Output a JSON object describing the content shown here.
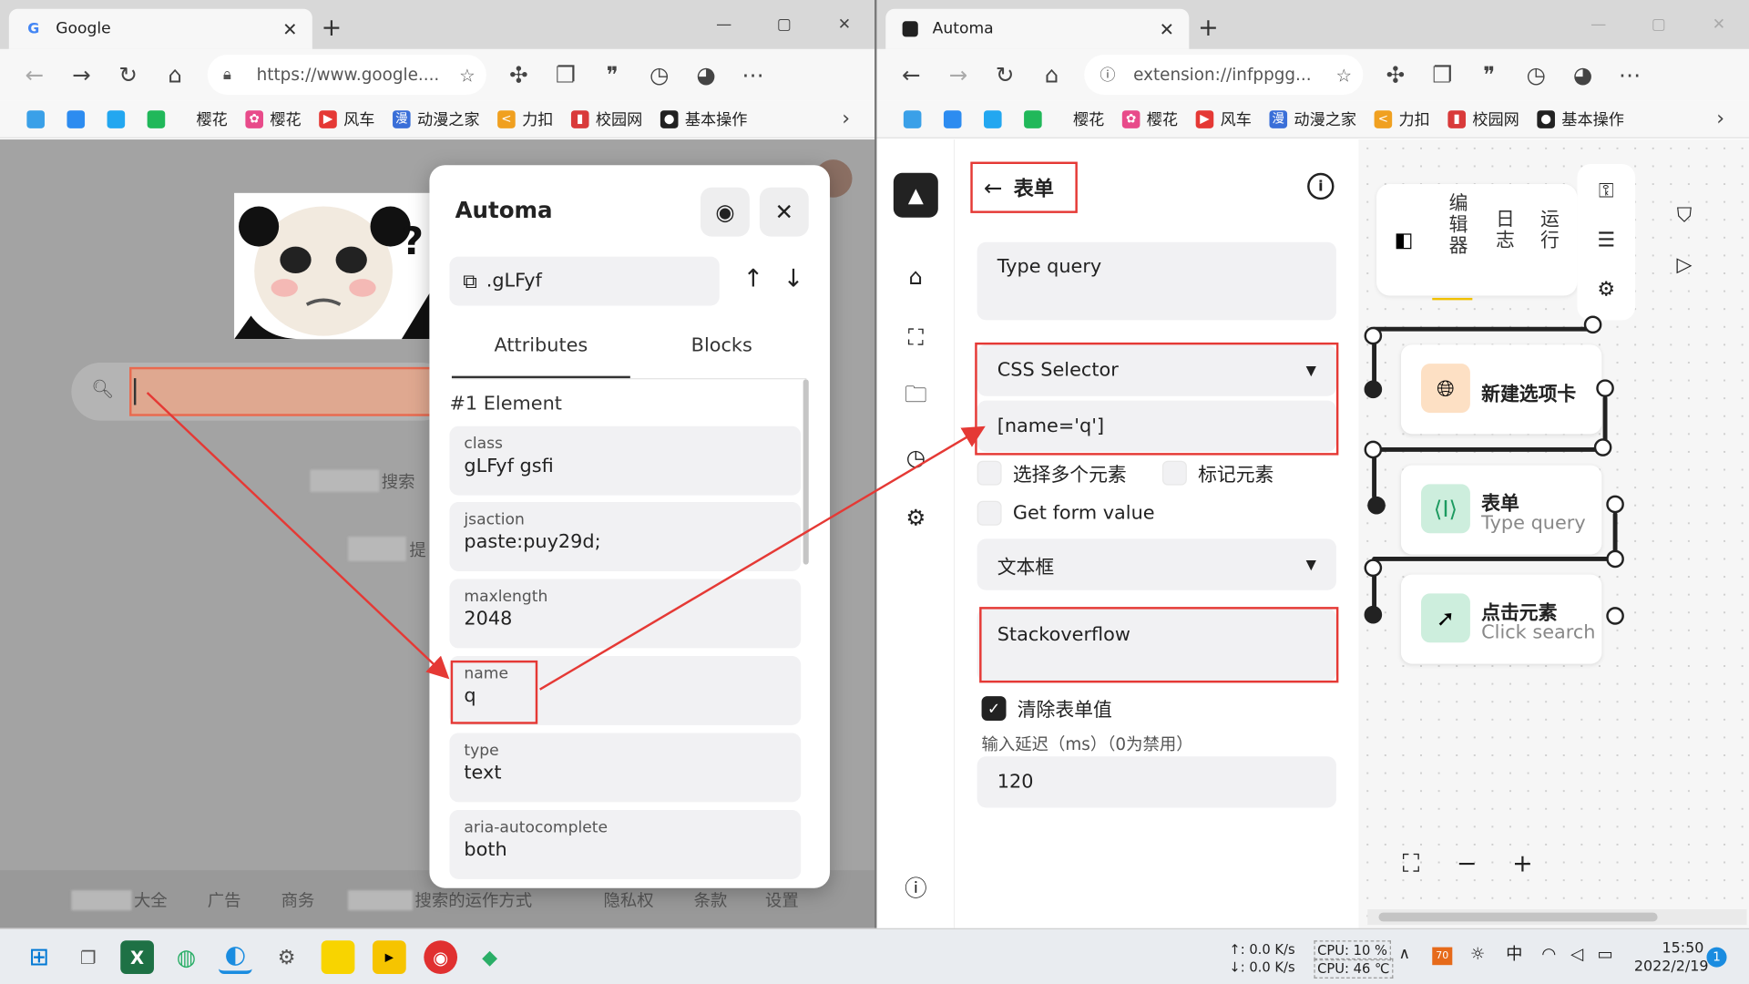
{
  "left_window": {
    "tab_title": "Google",
    "tab_favicon": "G",
    "url": "https://www.google....",
    "footer": [
      "大全",
      "广告",
      "商务",
      "搜索的运作方式",
      "隐私权",
      "条款",
      "设置"
    ],
    "search_text": "搜索",
    "tip_text": "提"
  },
  "right_window": {
    "tab_title": "Automa",
    "url": "extension://infppgg..."
  },
  "bookmarks": [
    {
      "label": "樱花",
      "color": "#ffffff",
      "glyph": ""
    },
    {
      "label": "樱花",
      "color": "#e84b8a",
      "glyph": "✿"
    },
    {
      "label": "风车",
      "color": "#e53935",
      "glyph": "▶"
    },
    {
      "label": "动漫之家",
      "color": "#3a6fd8",
      "glyph": "漫"
    },
    {
      "label": "力扣",
      "color": "#f0a020",
      "glyph": "<"
    },
    {
      "label": "校园网",
      "color": "#d93a3a",
      "glyph": "▮"
    },
    {
      "label": "基本操作",
      "color": "#222222",
      "glyph": "●"
    }
  ],
  "popup": {
    "title": "Automa",
    "selector": ".gLFyf",
    "tabs": [
      "Attributes",
      "Blocks"
    ],
    "element_heading": "#1 Element",
    "attributes": [
      {
        "key": "class",
        "value": "gLFyf gsfi"
      },
      {
        "key": "jsaction",
        "value": "paste:puy29d;"
      },
      {
        "key": "maxlength",
        "value": "2048"
      },
      {
        "key": "name",
        "value": "q"
      },
      {
        "key": "type",
        "value": "text"
      },
      {
        "key": "aria-autocomplete",
        "value": "both"
      }
    ]
  },
  "form": {
    "title": "表单",
    "description": "Type query",
    "selector_type": "CSS Selector",
    "selector_value": "[name='q']",
    "multiple_label": "选择多个元素",
    "mark_label": "标记元素",
    "get_value_label": "Get form value",
    "field_type": "文本框",
    "value": "Stackoverflow",
    "clear_label": "清除表单值",
    "clear_checked": true,
    "delay_label": "输入延迟（ms）（0为禁用）",
    "delay_value": "120"
  },
  "editor": {
    "tabs": [
      "编辑器",
      "日志",
      "运行"
    ],
    "nodes": [
      {
        "title": "新建选项卡",
        "subtitle": "",
        "icon": "globe-icon",
        "bg": "#fde0c4"
      },
      {
        "title": "表单",
        "subtitle": "Type query",
        "icon": "form-icon",
        "bg": "#cdeedd"
      },
      {
        "title": "点击元素",
        "subtitle": "Click search",
        "icon": "cursor-icon",
        "bg": "#cdeedd"
      }
    ]
  },
  "taskbar": {
    "net_up": "↑: 0.0 K/s",
    "net_down": "↓: 0.0 K/s",
    "cpu": "CPU: 10 %",
    "temp": "CPU: 46 ℃",
    "ime": "中",
    "time": "15:50",
    "date": "2022/2/19",
    "notif_count": "1"
  },
  "colors": {
    "highlight": "#e53935",
    "accent_dark": "#222222"
  }
}
